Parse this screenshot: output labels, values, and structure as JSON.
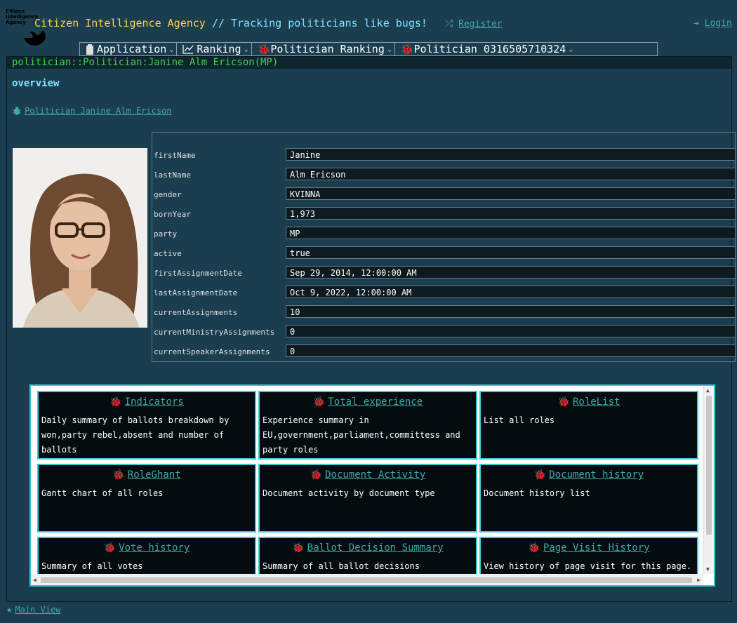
{
  "header": {
    "logo_text": "Citizen Intelligence Agency",
    "title": "Citizen Intelligence Agency",
    "subtitle": " // Tracking politicians like bugs!",
    "register": "Register",
    "login": "Login"
  },
  "menu": [
    {
      "icon": "clipboard-icon",
      "label": "Application"
    },
    {
      "icon": "chart-line-icon",
      "label": "Ranking"
    },
    {
      "icon": "bug-icon",
      "label": "Politician Ranking"
    },
    {
      "icon": "bug-icon",
      "label": "Politician 0316505710324"
    }
  ],
  "panel": {
    "caption": "politician::Politician:Janine Alm Ericson(MP)",
    "section": "overview",
    "politician_link": "Politician Janine Alm Ericson"
  },
  "fields": [
    {
      "label": "firstName",
      "value": "Janine"
    },
    {
      "label": "lastName",
      "value": "Alm Ericson"
    },
    {
      "label": "gender",
      "value": "KVINNA"
    },
    {
      "label": "bornYear",
      "value": "1,973"
    },
    {
      "label": "party",
      "value": "MP"
    },
    {
      "label": "active",
      "value": "true"
    },
    {
      "label": "firstAssignmentDate",
      "value": "Sep 29, 2014, 12:00:00 AM"
    },
    {
      "label": "lastAssignmentDate",
      "value": "Oct 9, 2022, 12:00:00 AM"
    },
    {
      "label": "currentAssignments",
      "value": "10"
    },
    {
      "label": "currentMinistryAssignments",
      "value": "0"
    },
    {
      "label": "currentSpeakerAssignments",
      "value": "0"
    }
  ],
  "cards": [
    {
      "title": "Indicators",
      "desc": "Daily summary of ballots breakdown by won,party rebel,absent and number of ballots"
    },
    {
      "title": "Total experience",
      "desc": "Experience summary in EU,government,parliament,committess and party roles"
    },
    {
      "title": "RoleList",
      "desc": "List all roles"
    },
    {
      "title": "RoleGhant",
      "desc": "Gantt chart of all roles"
    },
    {
      "title": "Document Activity",
      "desc": "Document activity by document type"
    },
    {
      "title": "Document history",
      "desc": "Document history list"
    },
    {
      "title": "Vote history",
      "desc": "Summary of all votes"
    },
    {
      "title": "Ballot Decision Summary",
      "desc": "Summary of all ballot decisions"
    },
    {
      "title": "Page Visit History",
      "desc": "View history of page visit for this page."
    }
  ],
  "footer": {
    "main_view": "Main View"
  },
  "colors": {
    "background": "#1a3d4f",
    "accent": "#37c9d9",
    "link": "#3fa9a6",
    "caption": "#3bd34a",
    "title_yellow": "#ffd24a"
  }
}
